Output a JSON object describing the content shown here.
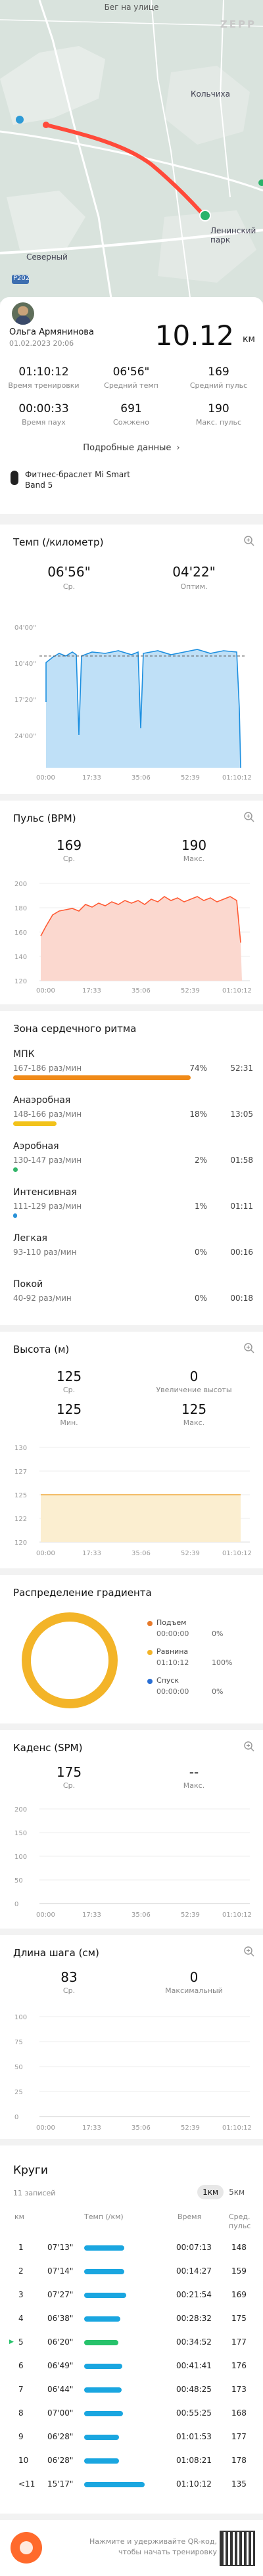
{
  "map": {
    "street_label": "Бег на улице",
    "brand": "ZEPP",
    "places": [
      "Кольчиха",
      "Ленинский парк",
      "Северный",
      "P202"
    ]
  },
  "summary": {
    "user_name": "Ольга Армянинова",
    "datetime": "01.02.2023 20:06",
    "distance": "10.12",
    "distance_unit": "км",
    "cells": [
      {
        "value": "01:10:12",
        "label": "Время тренировки"
      },
      {
        "value": "06'56\"",
        "label": "Средний темп"
      },
      {
        "value": "169",
        "label": "Средний пульс"
      },
      {
        "value": "00:00:33",
        "label": "Время паух"
      },
      {
        "value": "691",
        "label": "Сожжено"
      },
      {
        "value": "190",
        "label": "Макс. пульс"
      }
    ],
    "more_link": "Подробные данные",
    "device": "Фитнес-браслет Mi Smart Band 5"
  },
  "pace": {
    "title": "Темп (/километр)",
    "avg_value": "06'56\"",
    "avg_label": "Ср.",
    "best_value": "04'22\"",
    "best_label": "Оптим.",
    "y_ticks": [
      "04'00\"",
      "10'40\"",
      "17'20\"",
      "24'00\""
    ],
    "x_ticks": [
      "00:00",
      "17:33",
      "35:06",
      "52:39",
      "01:10:12"
    ]
  },
  "pulse": {
    "title": "Пульс (BPM)",
    "avg_value": "169",
    "avg_label": "Ср.",
    "max_value": "190",
    "max_label": "Макс.",
    "y_ticks": [
      "200",
      "180",
      "160",
      "140",
      "120"
    ],
    "x_ticks": [
      "00:00",
      "17:33",
      "35:06",
      "52:39",
      "01:10:12"
    ]
  },
  "zones": {
    "title": "Зона сердечного ритма",
    "items": [
      {
        "name": "МПК",
        "range": "167-186 раз/мин",
        "pct": "74%",
        "time": "52:31",
        "color": "#f08a18",
        "fraction": 0.74
      },
      {
        "name": "Анаэробная",
        "range": "148-166 раз/мин",
        "pct": "18%",
        "time": "13:05",
        "color": "#f2c21a",
        "fraction": 0.18
      },
      {
        "name": "Аэробная",
        "range": "130-147 раз/мин",
        "pct": "2%",
        "time": "01:58",
        "color": "#33b56a",
        "fraction": 0.02
      },
      {
        "name": "Интенсивная",
        "range": "111-129 раз/мин",
        "pct": "1%",
        "time": "01:11",
        "color": "#2a92d8",
        "fraction": 0.01
      },
      {
        "name": "Легкая",
        "range": "93-110 раз/мин",
        "pct": "0%",
        "time": "00:16",
        "color": "#bbbbbb",
        "fraction": 0.0
      },
      {
        "name": "Покой",
        "range": "40-92 раз/мин",
        "pct": "0%",
        "time": "00:18",
        "color": "#bbbbbb",
        "fraction": 0.0
      }
    ]
  },
  "altitude": {
    "title": "Высота (м)",
    "avg_value": "125",
    "avg_label": "Ср.",
    "gain_value": "0",
    "gain_label": "Увеличение высоты",
    "min_value": "125",
    "min_label": "Мин.",
    "max_value": "125",
    "max_label": "Макс.",
    "y_ticks": [
      "130",
      "127",
      "125",
      "122",
      "120"
    ],
    "x_ticks": [
      "00:00",
      "17:33",
      "35:06",
      "52:39",
      "01:10:12"
    ]
  },
  "gradient": {
    "title": "Распределение градиента",
    "legend": [
      {
        "name": "Подъем",
        "time": "00:00:00",
        "pct": "0%",
        "color": "#e77a2a"
      },
      {
        "name": "Равнина",
        "time": "01:10:12",
        "pct": "100%",
        "color": "#f3b428"
      },
      {
        "name": "Спуск",
        "time": "00:00:00",
        "pct": "0%",
        "color": "#2a6fd4"
      }
    ]
  },
  "cadence": {
    "title": "Каденс (SPM)",
    "avg_value": "175",
    "avg_label": "Ср.",
    "max_value": "--",
    "max_label": "Макс.",
    "y_ticks": [
      "200",
      "150",
      "100",
      "50",
      "0"
    ],
    "x_ticks": [
      "00:00",
      "17:33",
      "35:06",
      "52:39",
      "01:10:12"
    ]
  },
  "stride": {
    "title": "Длина шага (см)",
    "avg_value": "83",
    "avg_label": "Ср.",
    "max_value": "0",
    "max_label": "Максимальный",
    "y_ticks": [
      "100",
      "75",
      "50",
      "25",
      "0"
    ],
    "x_ticks": [
      "00:00",
      "17:33",
      "35:06",
      "52:39",
      "01:10:12"
    ]
  },
  "laps": {
    "title": "Круги",
    "count_label": "11 записей",
    "tabs": [
      "1км",
      "5км"
    ],
    "headers": [
      "км",
      "Темп (/км)",
      "Время",
      "Сред. пульс"
    ],
    "rows": [
      {
        "n": "1",
        "pace": "07'13\"",
        "time": "00:07:13",
        "hr": "148",
        "frac": 0.66
      },
      {
        "n": "2",
        "pace": "07'14\"",
        "time": "00:14:27",
        "hr": "159",
        "frac": 0.66
      },
      {
        "n": "3",
        "pace": "07'27\"",
        "time": "00:21:54",
        "hr": "169",
        "frac": 0.7
      },
      {
        "n": "4",
        "pace": "06'38\"",
        "time": "00:28:32",
        "hr": "175",
        "frac": 0.6
      },
      {
        "n": "5",
        "pace": "06'20\"",
        "time": "00:34:52",
        "hr": "177",
        "frac": 0.56,
        "fastest": true
      },
      {
        "n": "6",
        "pace": "06'49\"",
        "time": "00:41:41",
        "hr": "176",
        "frac": 0.63
      },
      {
        "n": "7",
        "pace": "06'44\"",
        "time": "00:48:25",
        "hr": "173",
        "frac": 0.62
      },
      {
        "n": "8",
        "pace": "07'00\"",
        "time": "00:55:25",
        "hr": "168",
        "frac": 0.64
      },
      {
        "n": "9",
        "pace": "06'28\"",
        "time": "01:01:53",
        "hr": "177",
        "frac": 0.58
      },
      {
        "n": "10",
        "pace": "06'28\"",
        "time": "01:08:21",
        "hr": "178",
        "frac": 0.58
      },
      {
        "n": "<11",
        "pace": "15'17\"",
        "time": "01:10:12",
        "hr": "135",
        "frac": 1.0
      }
    ]
  },
  "footer": {
    "line1": "Нажмите и удерживайте QR-код,",
    "line2": "чтобы начать тренировку"
  }
}
